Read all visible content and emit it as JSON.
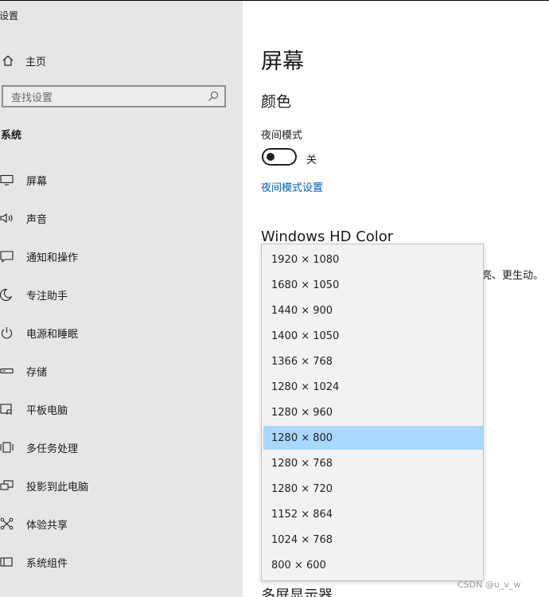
{
  "window": {
    "title": "设置"
  },
  "sidebar": {
    "home_label": "主页",
    "search_placeholder": "查找设置",
    "section_title": "系统",
    "items": [
      {
        "label": "屏幕",
        "icon": "monitor-icon"
      },
      {
        "label": "声音",
        "icon": "speaker-icon"
      },
      {
        "label": "通知和操作",
        "icon": "notification-icon"
      },
      {
        "label": "专注助手",
        "icon": "moon-icon"
      },
      {
        "label": "电源和睡眠",
        "icon": "power-icon"
      },
      {
        "label": "存储",
        "icon": "storage-icon"
      },
      {
        "label": "平板电脑",
        "icon": "tablet-icon"
      },
      {
        "label": "多任务处理",
        "icon": "multitask-icon"
      },
      {
        "label": "投影到此电脑",
        "icon": "project-icon"
      },
      {
        "label": "体验共享",
        "icon": "share-icon"
      },
      {
        "label": "系统组件",
        "icon": "components-icon"
      }
    ]
  },
  "main": {
    "title": "屏幕",
    "color_heading": "颜色",
    "night_mode_label": "夜间模式",
    "night_mode_state": "关",
    "night_mode_settings_link": "夜间模式设置",
    "hd_heading": "Windows HD Color",
    "hd_desc_fragment": "亮、更生动。",
    "multi_display_heading": "多屏显示器"
  },
  "resolution_dropdown": {
    "selected": "1280 × 800",
    "options": [
      "1920 × 1080",
      "1680 × 1050",
      "1440 × 900",
      "1400 × 1050",
      "1366 × 768",
      "1280 × 1024",
      "1280 × 960",
      "1280 × 800",
      "1280 × 768",
      "1280 × 720",
      "1152 × 864",
      "1024 × 768",
      "800 × 600"
    ]
  },
  "watermark": "CSDN @u_v_w",
  "colors": {
    "accent_link": "#005fb8",
    "selected_option": "#a8d7ff",
    "sidebar_bg": "#e6e6e6"
  }
}
